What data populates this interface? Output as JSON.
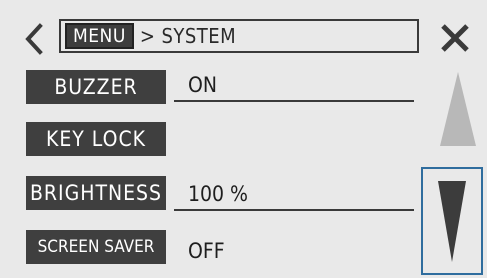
{
  "header": {
    "menu_label": "MENU",
    "separator": ">",
    "current_page": "SYSTEM"
  },
  "settings": [
    {
      "label": "BUZZER",
      "value": "ON"
    },
    {
      "label": "KEY LOCK",
      "value": ""
    },
    {
      "label": "BRIGHTNESS",
      "value": "100 %"
    },
    {
      "label": "SCREEN SAVER",
      "value": "OFF"
    }
  ],
  "icons": {
    "back": "chevron-left-icon",
    "close": "close-icon",
    "scroll_up": "triangle-up-icon",
    "scroll_down": "triangle-down-icon"
  },
  "colors": {
    "background": "#e9e9e9",
    "button": "#3f3f3f",
    "button_text": "#ffffff",
    "scroll_up_disabled": "#b8b8b8",
    "scroll_down_active": "#3c3c3c",
    "focus_frame": "#2f6d9e"
  }
}
